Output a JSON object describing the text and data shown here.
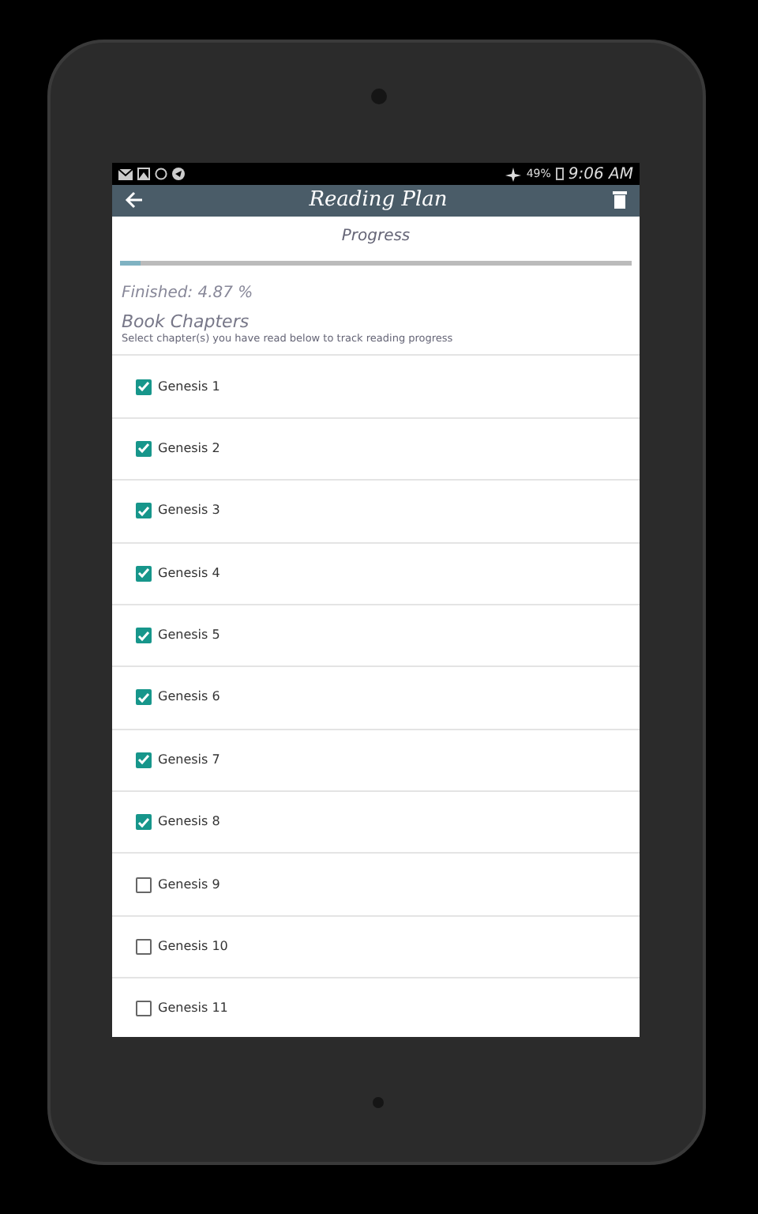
{
  "status_bar": {
    "time": "9:06 AM",
    "battery": "49%"
  },
  "toolbar": {
    "title": "Reading Plan"
  },
  "progress": {
    "label": "Progress",
    "level": 0.04
  },
  "finished": "Finished: 4.87 %",
  "section": {
    "title": "Book Chapters",
    "subtitle": "Select chapter(s) you have read below to track reading progress"
  },
  "chapters": [
    {
      "label": "Genesis 1",
      "checked": true
    },
    {
      "label": "Genesis 2",
      "checked": true
    },
    {
      "label": "Genesis 3",
      "checked": true
    },
    {
      "label": "Genesis 4",
      "checked": true
    },
    {
      "label": "Genesis 5",
      "checked": true
    },
    {
      "label": "Genesis 6",
      "checked": true
    },
    {
      "label": "Genesis 7",
      "checked": true
    },
    {
      "label": "Genesis 8",
      "checked": true
    },
    {
      "label": "Genesis 9",
      "checked": false
    },
    {
      "label": "Genesis 10",
      "checked": false
    },
    {
      "label": "Genesis 11",
      "checked": false
    }
  ]
}
